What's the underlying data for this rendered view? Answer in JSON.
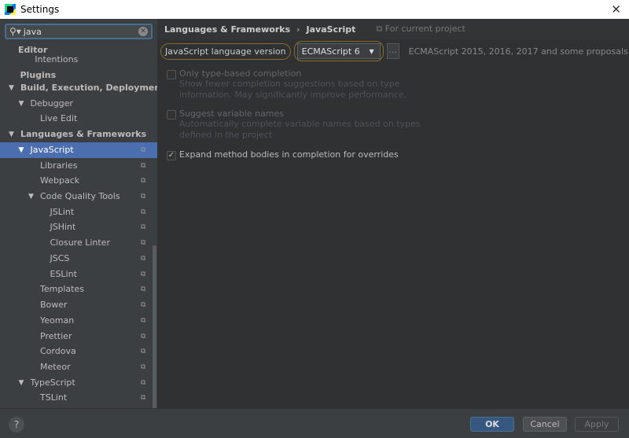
{
  "window": {
    "title": "Settings",
    "close": "✕"
  },
  "search": {
    "value": "java",
    "icon": "search-icon"
  },
  "tree": [
    {
      "label": "Editor",
      "level": 0,
      "bold": true,
      "arrow": false
    },
    {
      "label": "Intentions",
      "level": 1.7,
      "bold": false,
      "arrow": false
    },
    {
      "label": "Plugins",
      "level": 0.2,
      "bold": true,
      "arrow": false
    },
    {
      "label": "Build, Execution, Deployment",
      "level": 0,
      "bold": true,
      "arrow": true
    },
    {
      "label": "Debugger",
      "level": 1,
      "arrow": true
    },
    {
      "label": "Live Edit",
      "level": 2
    },
    {
      "label": "Languages & Frameworks",
      "level": 0,
      "bold": true,
      "arrow": true
    },
    {
      "label": "JavaScript",
      "level": 1,
      "arrow": true,
      "selected": true,
      "copy": true
    },
    {
      "label": "Libraries",
      "level": 2,
      "copy": true
    },
    {
      "label": "Webpack",
      "level": 2,
      "copy": true
    },
    {
      "label": "Code Quality Tools",
      "level": 2,
      "arrow": true,
      "copy": true
    },
    {
      "label": "JSLint",
      "level": 3,
      "copy": true
    },
    {
      "label": "JSHint",
      "level": 3,
      "copy": true
    },
    {
      "label": "Closure Linter",
      "level": 3,
      "copy": true
    },
    {
      "label": "JSCS",
      "level": 3,
      "copy": true
    },
    {
      "label": "ESLint",
      "level": 3,
      "copy": true
    },
    {
      "label": "Templates",
      "level": 2,
      "copy": true
    },
    {
      "label": "Bower",
      "level": 2,
      "copy": true
    },
    {
      "label": "Yeoman",
      "level": 2,
      "copy": true
    },
    {
      "label": "Prettier",
      "level": 2,
      "copy": true
    },
    {
      "label": "Cordova",
      "level": 2,
      "copy": true
    },
    {
      "label": "Meteor",
      "level": 2,
      "copy": true
    },
    {
      "label": "TypeScript",
      "level": 1,
      "arrow": true,
      "copy": true
    },
    {
      "label": "TSLint",
      "level": 2,
      "copy": true
    }
  ],
  "breadcrumb": {
    "parent": "Languages & Frameworks",
    "sep": "›",
    "current": "JavaScript",
    "scope": "For current project"
  },
  "version": {
    "label": "JavaScript language version",
    "value": "ECMAScript 6",
    "more": "...",
    "description": "ECMAScript 2015, 2016, 2017 and some proposals"
  },
  "options": [
    {
      "label": "Only type-based completion",
      "desc": "Show fewer completion suggestions based on type information. May significantly improve performance.",
      "checked": false,
      "enabled": false
    },
    {
      "label": "Suggest variable names",
      "desc": "Automatically complete variable names based on types defined in the project",
      "checked": false,
      "enabled": false
    },
    {
      "label": "Expand method bodies in completion for overrides",
      "checked": true,
      "enabled": true
    }
  ],
  "footer": {
    "help": "?",
    "ok": "OK",
    "cancel": "Cancel",
    "apply": "Apply"
  },
  "colors": {
    "selection": "#4b6eaf",
    "highlight": "#8a6d2a",
    "ok": "#365880"
  }
}
